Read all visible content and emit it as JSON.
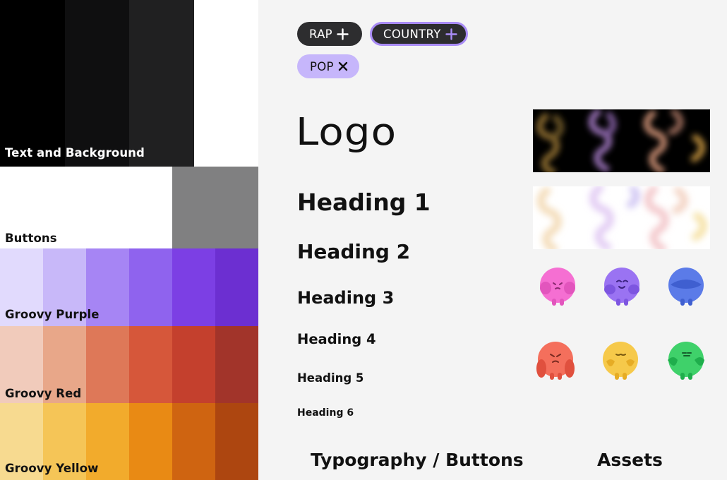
{
  "palette": {
    "text_background": {
      "label": "Text and Background",
      "colors": [
        "#000000",
        "#0f0f10",
        "#202021",
        "#ffffff"
      ]
    },
    "buttons": {
      "label": "Buttons",
      "colors": [
        "#ffffff",
        "#808081"
      ]
    },
    "purple": {
      "label": "Groovy Purple",
      "colors": [
        "#e1dafd",
        "#c8b8f9",
        "#a685f4",
        "#8f63ee",
        "#7c3fe4",
        "#6c2fd1"
      ]
    },
    "red": {
      "label": "Groovy Red",
      "colors": [
        "#f1cbbb",
        "#e8a789",
        "#de7858",
        "#d6573a",
        "#c4402d",
        "#a2342a"
      ]
    },
    "yellow": {
      "label": "Groovy Yellow",
      "colors": [
        "#f7da90",
        "#f5c557",
        "#f2ab2c",
        "#e98a14",
        "#cf6411",
        "#ad4610"
      ]
    }
  },
  "chips": {
    "rap": {
      "label": "RAP",
      "icon": "plus-icon"
    },
    "country": {
      "label": "COUNTRY",
      "icon": "plus-icon"
    },
    "pop": {
      "label": "POP",
      "icon": "close-icon"
    }
  },
  "typography": {
    "logo": "Logo",
    "h1": "Heading 1",
    "h2": "Heading 2",
    "h3": "Heading 3",
    "h4": "Heading 4",
    "h5": "Heading 5",
    "h6": "Heading 6"
  },
  "sections": {
    "typography_buttons": "Typography / Buttons",
    "assets": "Assets"
  },
  "characters": [
    {
      "name": "pink-character",
      "color": "#f56fd2"
    },
    {
      "name": "purple-character",
      "color": "#9a73f2"
    },
    {
      "name": "blue-character",
      "color": "#5b7be8"
    },
    {
      "name": "red-character",
      "color": "#f46f5c"
    },
    {
      "name": "yellow-character",
      "color": "#f6c94a"
    },
    {
      "name": "green-character",
      "color": "#3fd16a"
    }
  ]
}
